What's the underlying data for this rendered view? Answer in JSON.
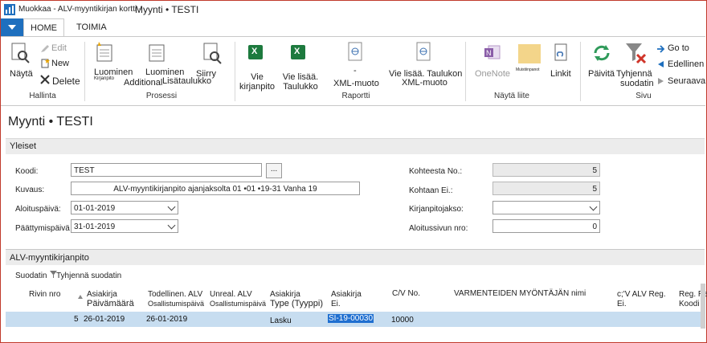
{
  "window": {
    "title_small": "Muokkaa - ALV-myyntikirjan kortti -",
    "title_main": "Myynti • TESTI"
  },
  "tabs": [
    "HOME",
    "TOIMIA"
  ],
  "ribbon": {
    "nayta": "Näytä",
    "edit": "Edit",
    "new": "New",
    "delete": "Delete",
    "luominen1": "Luominen",
    "kirjanpito_small": "Kirjanpito",
    "additional": "Additional",
    "luominen2": "Luominen",
    "lisataulukko": "Lisätaulukko",
    "siirry": "Siirry",
    "vie_kirjanpito": "Vie kirjanpito",
    "vie_lisaa_taulukko": "Vie lisää. Taulukko",
    "xml_dash": "-",
    "xml_muoto": "XML-muoto",
    "vie_lisaa_taulukon": "Vie lisää. Taulukon",
    "xml_muoto2": "XML-muoto",
    "onenote": "OneNote",
    "muistiinpanot": "Muistiinpanot",
    "linkit": "Linkit",
    "paivita": "Päivitä",
    "tyhjenna_suodatin_line1": "Tyhjennä",
    "tyhjenna_suodatin_line2": "suodatin",
    "goto": "Go to",
    "edellinen": "Edellinen",
    "seuraava": "Seuraava",
    "groups": {
      "hallinta": "Hallinta",
      "prosessi": "Prosessi",
      "raportti": "Raportti",
      "nayta_liite": "Näytä liite",
      "sivu": "Sivu"
    }
  },
  "page_title": "Myynti • TESTI",
  "yleiset": {
    "header": "Yleiset",
    "koodi_label": "Koodi:",
    "koodi_value": "TEST",
    "kuvaus_label": "Kuvaus:",
    "kuvaus_value": "ALV-myyntikirjanpito ajanjaksolta 01 •01 •19-31 Vanha 19",
    "aloituspaiva_label": "Aloituspäivä:",
    "aloituspaiva_value": "01-01-2019",
    "paattymispaiva_label": "Päättymispäivä",
    "paattymispaiva_value": "31-01-2019",
    "kohteesta_label": "Kohteesta No.:",
    "kohteesta_value": "5",
    "kohtaan_label": "Kohtaan Ei.:",
    "kohtaan_value": "5",
    "kirjanpitojakso_label": "Kirjanpitojakso:",
    "kirjanpitojakso_value": "",
    "aloitussivun_label": "Aloitussivun nro:",
    "aloitussivun_value": "0"
  },
  "sub": {
    "header": "ALV-myyntikirjanpito",
    "suodatin": "Suodatin",
    "tyhjenna_suodatin": "Tyhjennä suodatin",
    "columns": {
      "rivin_nro": "Rivin nro",
      "asiakirja_paivamaara_1": "Asiakirja",
      "asiakirja_paivamaara_2": "Päivämäärä",
      "todellinen_1": "Todellinen. ALV",
      "todellinen_2": "Osallistumispäivä",
      "unreal_1": "Unreal. ALV",
      "unreal_2": "Osallistumispäivä",
      "asiakirja_type_1": "Asiakirja",
      "asiakirja_type_2": "Type (Tyyppi)",
      "asiakirja_ei_1": "Asiakirja",
      "asiakirja_ei_2": "Ei.",
      "cv_no": "C/V No.",
      "varmenteiden": "VARMENTEIDEN MYÖNTÄJÄN nimi",
      "cv_alv_1": "c;'V ALV Reg.",
      "cv_alv_2": "Ei.",
      "reg_1": "Reg. Re",
      "reg_2": "Koodi"
    },
    "rows": [
      {
        "rivin_nro": "5",
        "asiakirja_paivamaara": "26-01-2019",
        "todellinen": "26-01-2019",
        "unreal": "",
        "type": "Lasku",
        "asiakirja_ei": "SI-19-00030",
        "cv_no": "10000",
        "varmenteiden": "",
        "cv_alv": "",
        "reg": ""
      }
    ]
  },
  "colors": {
    "accent": "#1e6fbe",
    "row_highlight": "#c7ddf0",
    "selection": "#1f6fd0",
    "excel_green": "#1d7a3e",
    "frame_red": "#c0392b"
  }
}
